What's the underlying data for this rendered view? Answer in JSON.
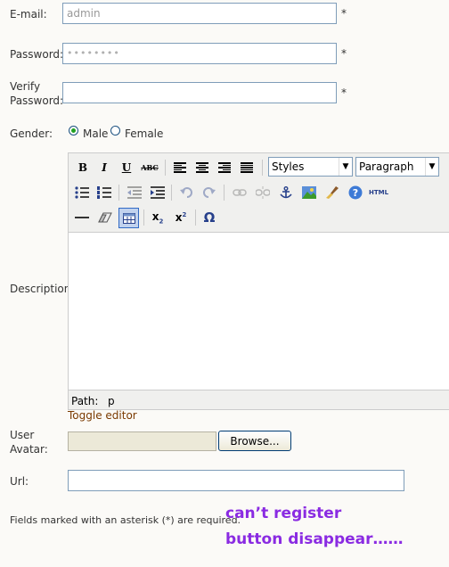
{
  "form": {
    "email": {
      "label": "E-mail:",
      "value": "admin",
      "required_mark": "*"
    },
    "password": {
      "label": "Password:",
      "value": "••••••••",
      "required_mark": "*"
    },
    "verify": {
      "label_line1": "Verify",
      "label_line2": "Password:",
      "value": "",
      "required_mark": "*"
    },
    "gender": {
      "label": "Gender:",
      "options": [
        "Male",
        "Female"
      ],
      "selected": "Male"
    },
    "description": {
      "label": "Description:"
    },
    "avatar": {
      "label_line1": "User",
      "label_line2": "Avatar:",
      "browse_label": "Browse..."
    },
    "url": {
      "label": "Url:",
      "value": ""
    },
    "required_note": "Fields marked with an asterisk (*) are required."
  },
  "editor": {
    "toolbar_row1": {
      "bold": "B",
      "italic": "I",
      "underline": "U",
      "strike": "ABC",
      "styles_value": "Styles",
      "format_value": "Paragraph"
    },
    "html_button": "HTML",
    "omega": "Ω",
    "path_label": "Path:",
    "path_value": "p",
    "toggle_label": "Toggle editor",
    "icons": [
      "bold-icon",
      "italic-icon",
      "underline-icon",
      "strikethrough-icon",
      "align-left-icon",
      "align-center-icon",
      "align-right-icon",
      "align-justify-icon",
      "bullet-list-icon",
      "numbered-list-icon",
      "outdent-icon",
      "indent-icon",
      "undo-icon",
      "redo-icon",
      "link-icon",
      "unlink-icon",
      "anchor-icon",
      "image-icon",
      "cleanup-icon",
      "help-icon",
      "html-icon",
      "horizontal-rule-icon",
      "eraser-icon",
      "table-icon",
      "subscript-icon",
      "superscript-icon",
      "special-char-icon"
    ]
  },
  "annotation": {
    "line1": "can’t register",
    "line2": "button disappear……",
    "color": "#8a2be2"
  }
}
